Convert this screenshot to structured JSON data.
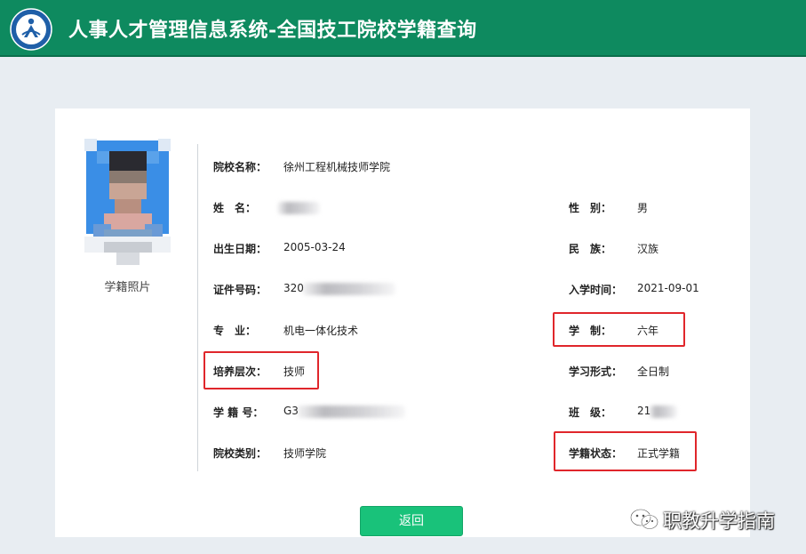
{
  "header": {
    "title": "人事人才管理信息系统-全国技工院校学籍查询",
    "logo_icon": "person-circle-logo-icon",
    "brand_color": "#0e8a5f"
  },
  "photo": {
    "caption": "学籍照片"
  },
  "fields": {
    "school_name": {
      "label": "院校名称：",
      "value": "徐州工程机械技师学院"
    },
    "name": {
      "label": "姓　名：",
      "value": ""
    },
    "gender": {
      "label": "性　别：",
      "value": "男"
    },
    "birth_date": {
      "label": "出生日期：",
      "value": "2005-03-24"
    },
    "ethnicity": {
      "label": "民　族：",
      "value": "汉族"
    },
    "id_number": {
      "label": "证件号码：",
      "value": "320"
    },
    "enroll_date": {
      "label": "入学时间：",
      "value": "2021-09-01"
    },
    "major": {
      "label": "专　业：",
      "value": "机电一体化技术"
    },
    "duration": {
      "label": "学　制：",
      "value": "六年"
    },
    "training_level": {
      "label": "培养层次：",
      "value": "技师"
    },
    "study_form": {
      "label": "学习形式：",
      "value": "全日制"
    },
    "student_id": {
      "label": "学 籍 号：",
      "value": "G3"
    },
    "class": {
      "label": "班　级：",
      "value": "21"
    },
    "school_type": {
      "label": "院校类别：",
      "value": "技师学院"
    },
    "status": {
      "label": "学籍状态：",
      "value": "正式学籍"
    }
  },
  "buttons": {
    "back_label": "返回"
  },
  "watermark": {
    "text": "职教升学指南",
    "icon": "wechat-icon"
  },
  "colors": {
    "highlight": "#e0262b",
    "button": "#19c27a"
  }
}
